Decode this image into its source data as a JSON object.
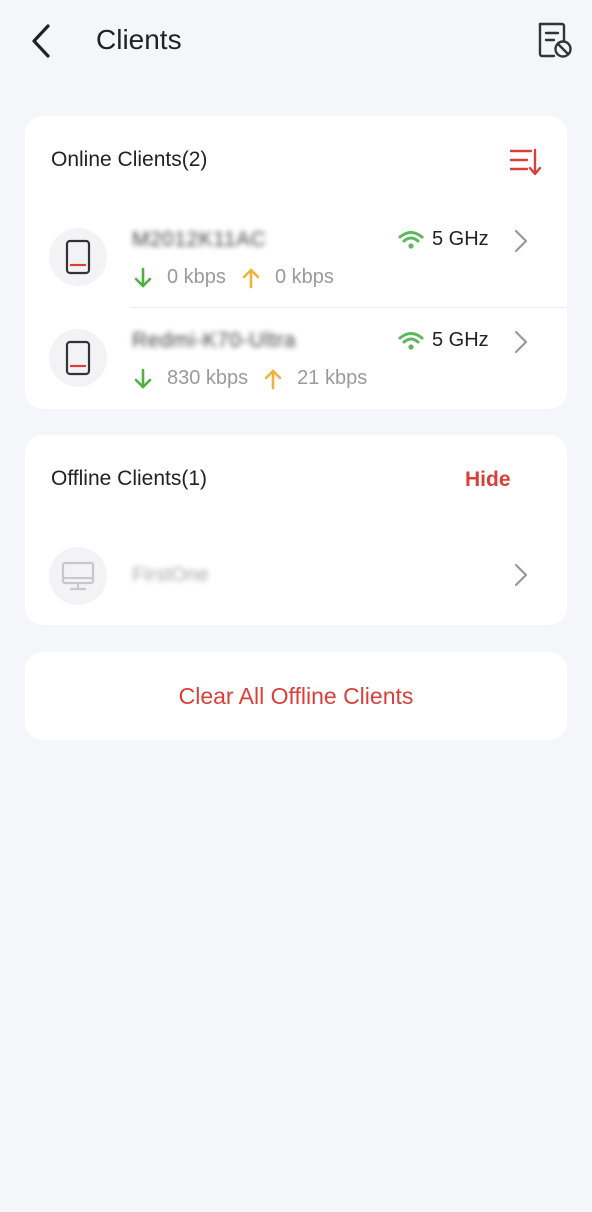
{
  "header": {
    "title": "Clients",
    "back_icon": "chevron-left-icon",
    "action_icon": "blacklist-doc-icon"
  },
  "online": {
    "title": "Online Clients(2)",
    "sort_icon": "sort-icon",
    "clients": [
      {
        "name": "M2012K11AC",
        "band": "5 GHz",
        "download": "0 kbps",
        "upload": "0 kbps",
        "device": "phone-icon"
      },
      {
        "name": "Redmi-K70-Ultra",
        "band": "5 GHz",
        "download": "830 kbps",
        "upload": "21 kbps",
        "device": "phone-icon"
      }
    ]
  },
  "offline": {
    "title": "Offline Clients(1)",
    "hide_label": "Hide",
    "clients": [
      {
        "name": "FirstOne",
        "device": "monitor-icon"
      }
    ]
  },
  "clear_all_label": "Clear All Offline Clients",
  "colors": {
    "accent": "#d9403a",
    "wifi": "#5cb85c",
    "download_arrow": "#52b043",
    "upload_arrow": "#f0b43c",
    "background": "#f4f6fa"
  }
}
